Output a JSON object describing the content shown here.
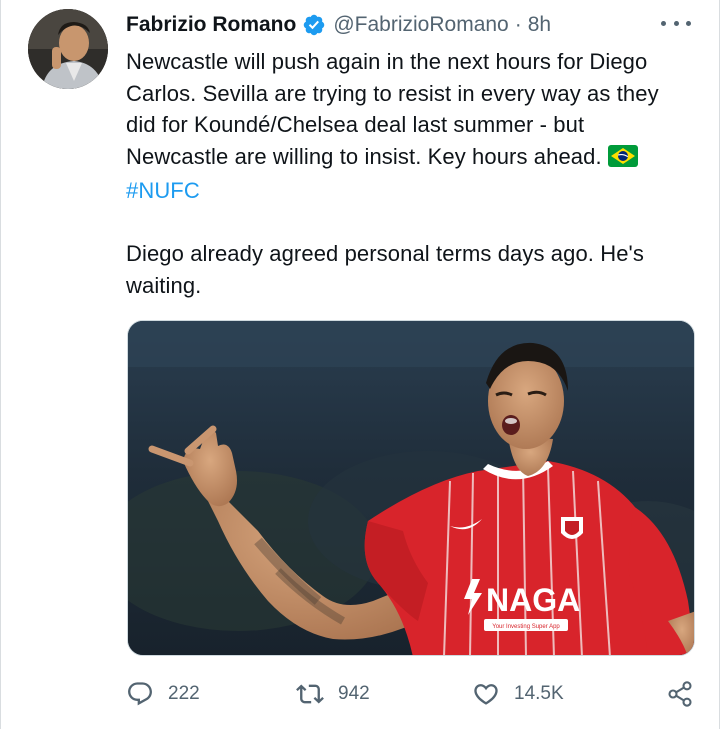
{
  "tweet": {
    "author_name": "Fabrizio Romano",
    "handle": "@FabrizioRomano",
    "separator": "·",
    "time": "8h",
    "lines": [
      "Newcastle will push again in the next hours for Diego",
      "Carlos. Sevilla are trying to resist in every way as they",
      "did for Koundé/Chelsea deal last summer - but",
      "Newcastle are willing to insist. Key hours ahead."
    ],
    "hashtag": "#NUFC",
    "second_paragraph": [
      "Diego already agreed personal terms days ago. He's",
      "waiting."
    ],
    "media": {
      "shirt_sponsor": "NAGA",
      "sponsor_tagline": "Your Investing Super App"
    }
  },
  "actions": {
    "replies": "222",
    "retweets": "942",
    "likes": "14.5K"
  },
  "icons": {
    "verified": "verified-badge-icon",
    "more": "more-options-icon",
    "reply": "reply-icon",
    "retweet": "retweet-icon",
    "like": "heart-icon",
    "share": "share-icon",
    "flag": "brazil-flag-icon"
  },
  "colors": {
    "link": "#1d9bf0",
    "secondary_text": "#536471",
    "primary_text": "#0f1419",
    "jersey_red": "#d8242b"
  }
}
